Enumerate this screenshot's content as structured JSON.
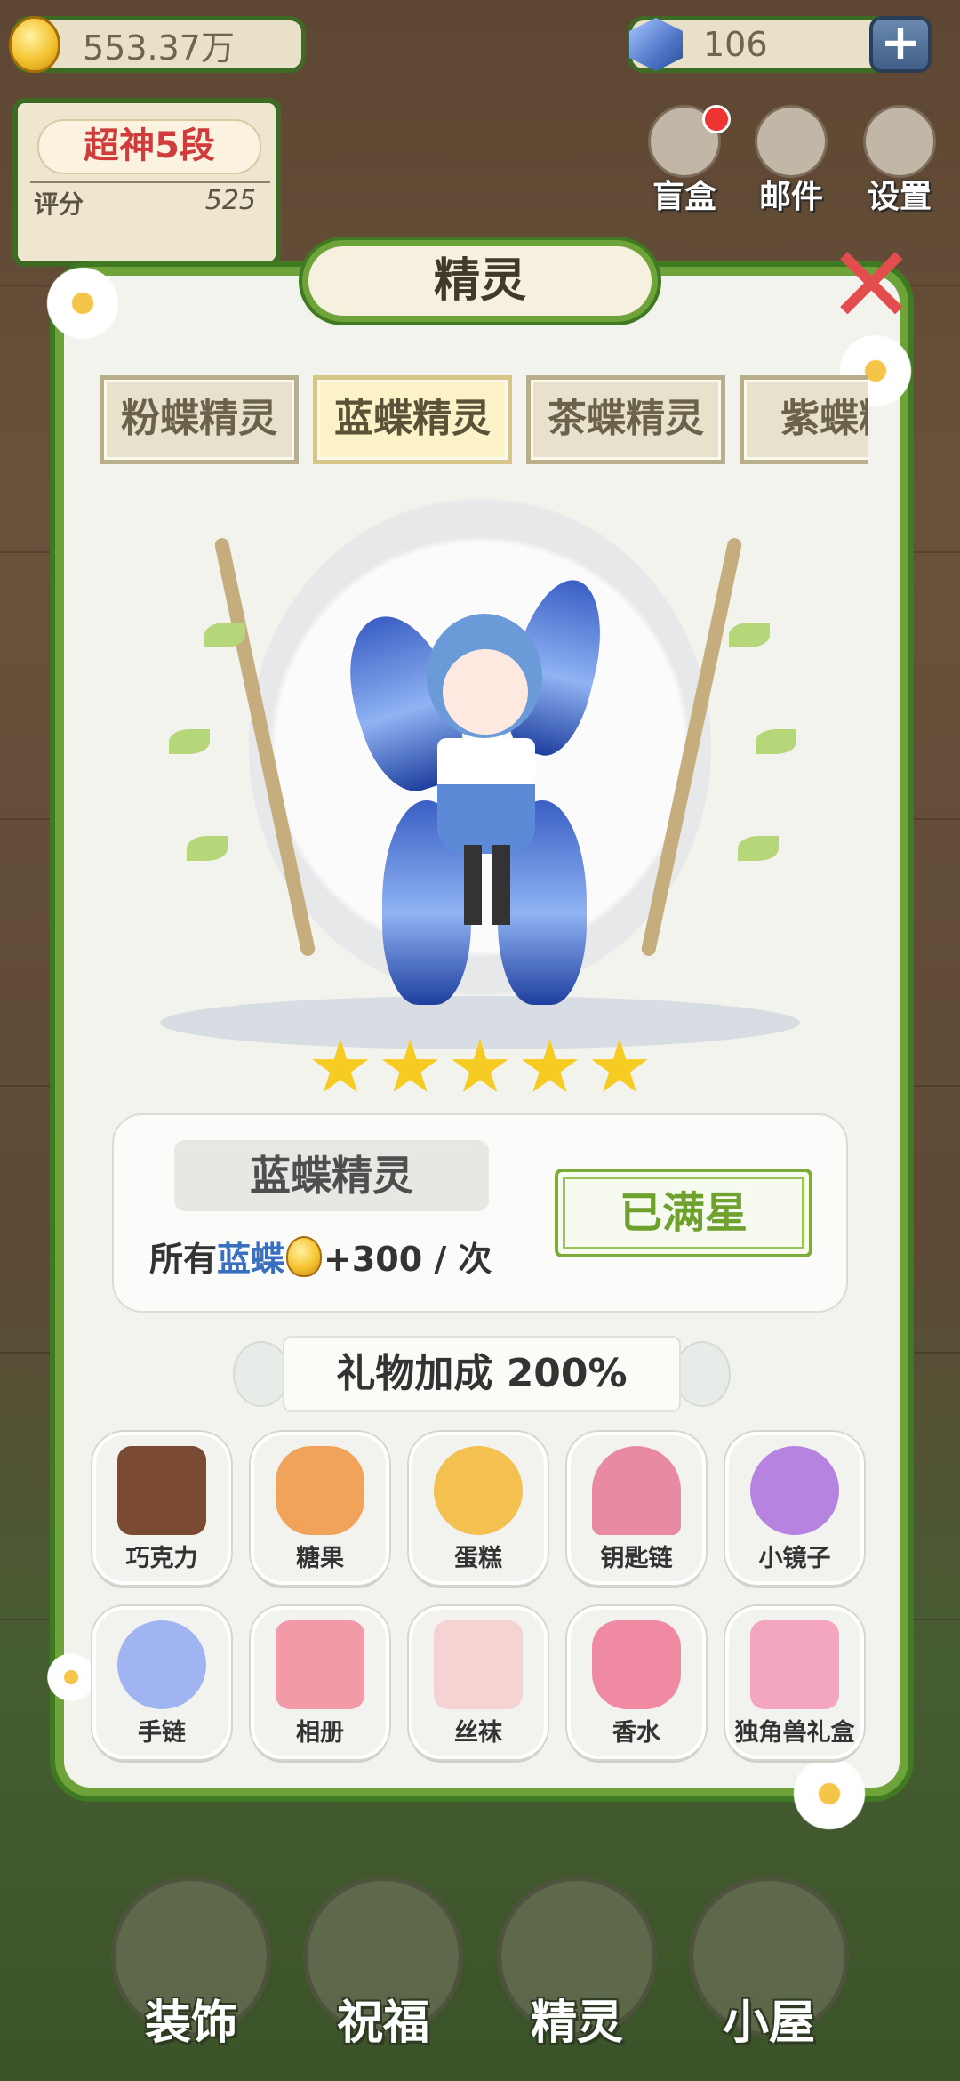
{
  "hud": {
    "coins": "553.37万",
    "gems": "106",
    "add_label": "+"
  },
  "rank": {
    "title": "超神5段",
    "score_label": "评分",
    "score": "525"
  },
  "top_buttons": [
    {
      "label": "盲盒",
      "icon": "blind-box-icon"
    },
    {
      "label": "邮件",
      "icon": "mail-icon"
    },
    {
      "label": "设置",
      "icon": "gear-icon"
    }
  ],
  "panel": {
    "title": "精灵",
    "close_label": "✕",
    "tabs": [
      {
        "label": "粉蝶精灵",
        "active": false
      },
      {
        "label": "蓝蝶精灵",
        "active": true
      },
      {
        "label": "茶蝶精灵",
        "active": false
      },
      {
        "label": "紫蝶精",
        "active": false
      }
    ],
    "star_count": 5,
    "selected": {
      "name": "蓝蝶精灵",
      "bonus_prefix": "所有",
      "bonus_target": "蓝蝶",
      "bonus_value": "+300 / 次",
      "status_button": "已满星"
    },
    "gift_bonus": "礼物加成 200%",
    "gifts": [
      {
        "label": "巧克力",
        "icon": "chocolate-icon",
        "color": "#7a4a32"
      },
      {
        "label": "糖果",
        "icon": "candy-jar-icon",
        "color": "#f2a35a"
      },
      {
        "label": "蛋糕",
        "icon": "cake-icon",
        "color": "#f4c04f"
      },
      {
        "label": "钥匙链",
        "icon": "keychain-icon",
        "color": "#e98aa3"
      },
      {
        "label": "小镜子",
        "icon": "mirror-icon",
        "color": "#b783e0"
      },
      {
        "label": "手链",
        "icon": "bracelet-icon",
        "color": "#9fb4f0"
      },
      {
        "label": "相册",
        "icon": "photo-album-icon",
        "color": "#f29aa8"
      },
      {
        "label": "丝袜",
        "icon": "stockings-icon",
        "color": "#f6d3d3"
      },
      {
        "label": "香水",
        "icon": "perfume-icon",
        "color": "#f08aa2"
      },
      {
        "label": "独角兽礼盒",
        "icon": "unicorn-gift-box-icon",
        "color": "#f4a6c0"
      }
    ]
  },
  "bottom_nav": [
    {
      "label": "装饰",
      "icon": "plant-icon"
    },
    {
      "label": "祝福",
      "icon": "blessing-icon"
    },
    {
      "label": "精灵",
      "icon": "fairy-icon"
    },
    {
      "label": "小屋",
      "icon": "house-icon"
    }
  ]
}
